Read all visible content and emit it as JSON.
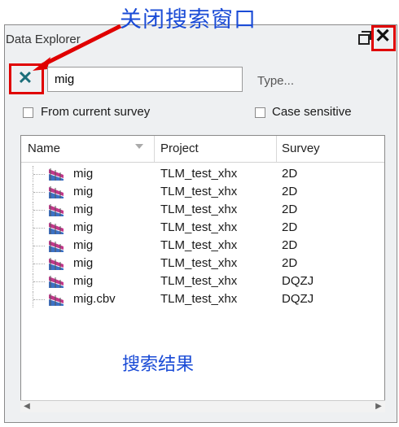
{
  "window": {
    "title": "Data Explorer",
    "close_glyph": "✕",
    "float_icon": "float-window-icon"
  },
  "search": {
    "clear_icon": "clear-search-icon",
    "clear_glyph": "✕",
    "value": "mig",
    "type_placeholder": "Type..."
  },
  "options": {
    "from_current_survey": "From current survey",
    "case_sensitive": "Case sensitive"
  },
  "table": {
    "headers": [
      "Name",
      "Project",
      "Survey"
    ],
    "rows": [
      {
        "name": "mig",
        "project": "TLM_test_xhx",
        "survey": "2D"
      },
      {
        "name": "mig",
        "project": "TLM_test_xhx",
        "survey": "2D"
      },
      {
        "name": "mig",
        "project": "TLM_test_xhx",
        "survey": "2D"
      },
      {
        "name": "mig",
        "project": "TLM_test_xhx",
        "survey": "2D"
      },
      {
        "name": "mig",
        "project": "TLM_test_xhx",
        "survey": "2D"
      },
      {
        "name": "mig",
        "project": "TLM_test_xhx",
        "survey": "2D"
      },
      {
        "name": "mig",
        "project": "TLM_test_xhx",
        "survey": "DQZJ"
      },
      {
        "name": "mig.cbv",
        "project": "TLM_test_xhx",
        "survey": "DQZJ"
      }
    ]
  },
  "scrollbar": {
    "left_glyph": "◀",
    "right_glyph": "▶"
  },
  "annotations": {
    "close_search_window": "关闭搜索窗口",
    "search_results": "搜索结果",
    "highlight_color": "#e00000",
    "text_color": "#1a4bd6"
  }
}
